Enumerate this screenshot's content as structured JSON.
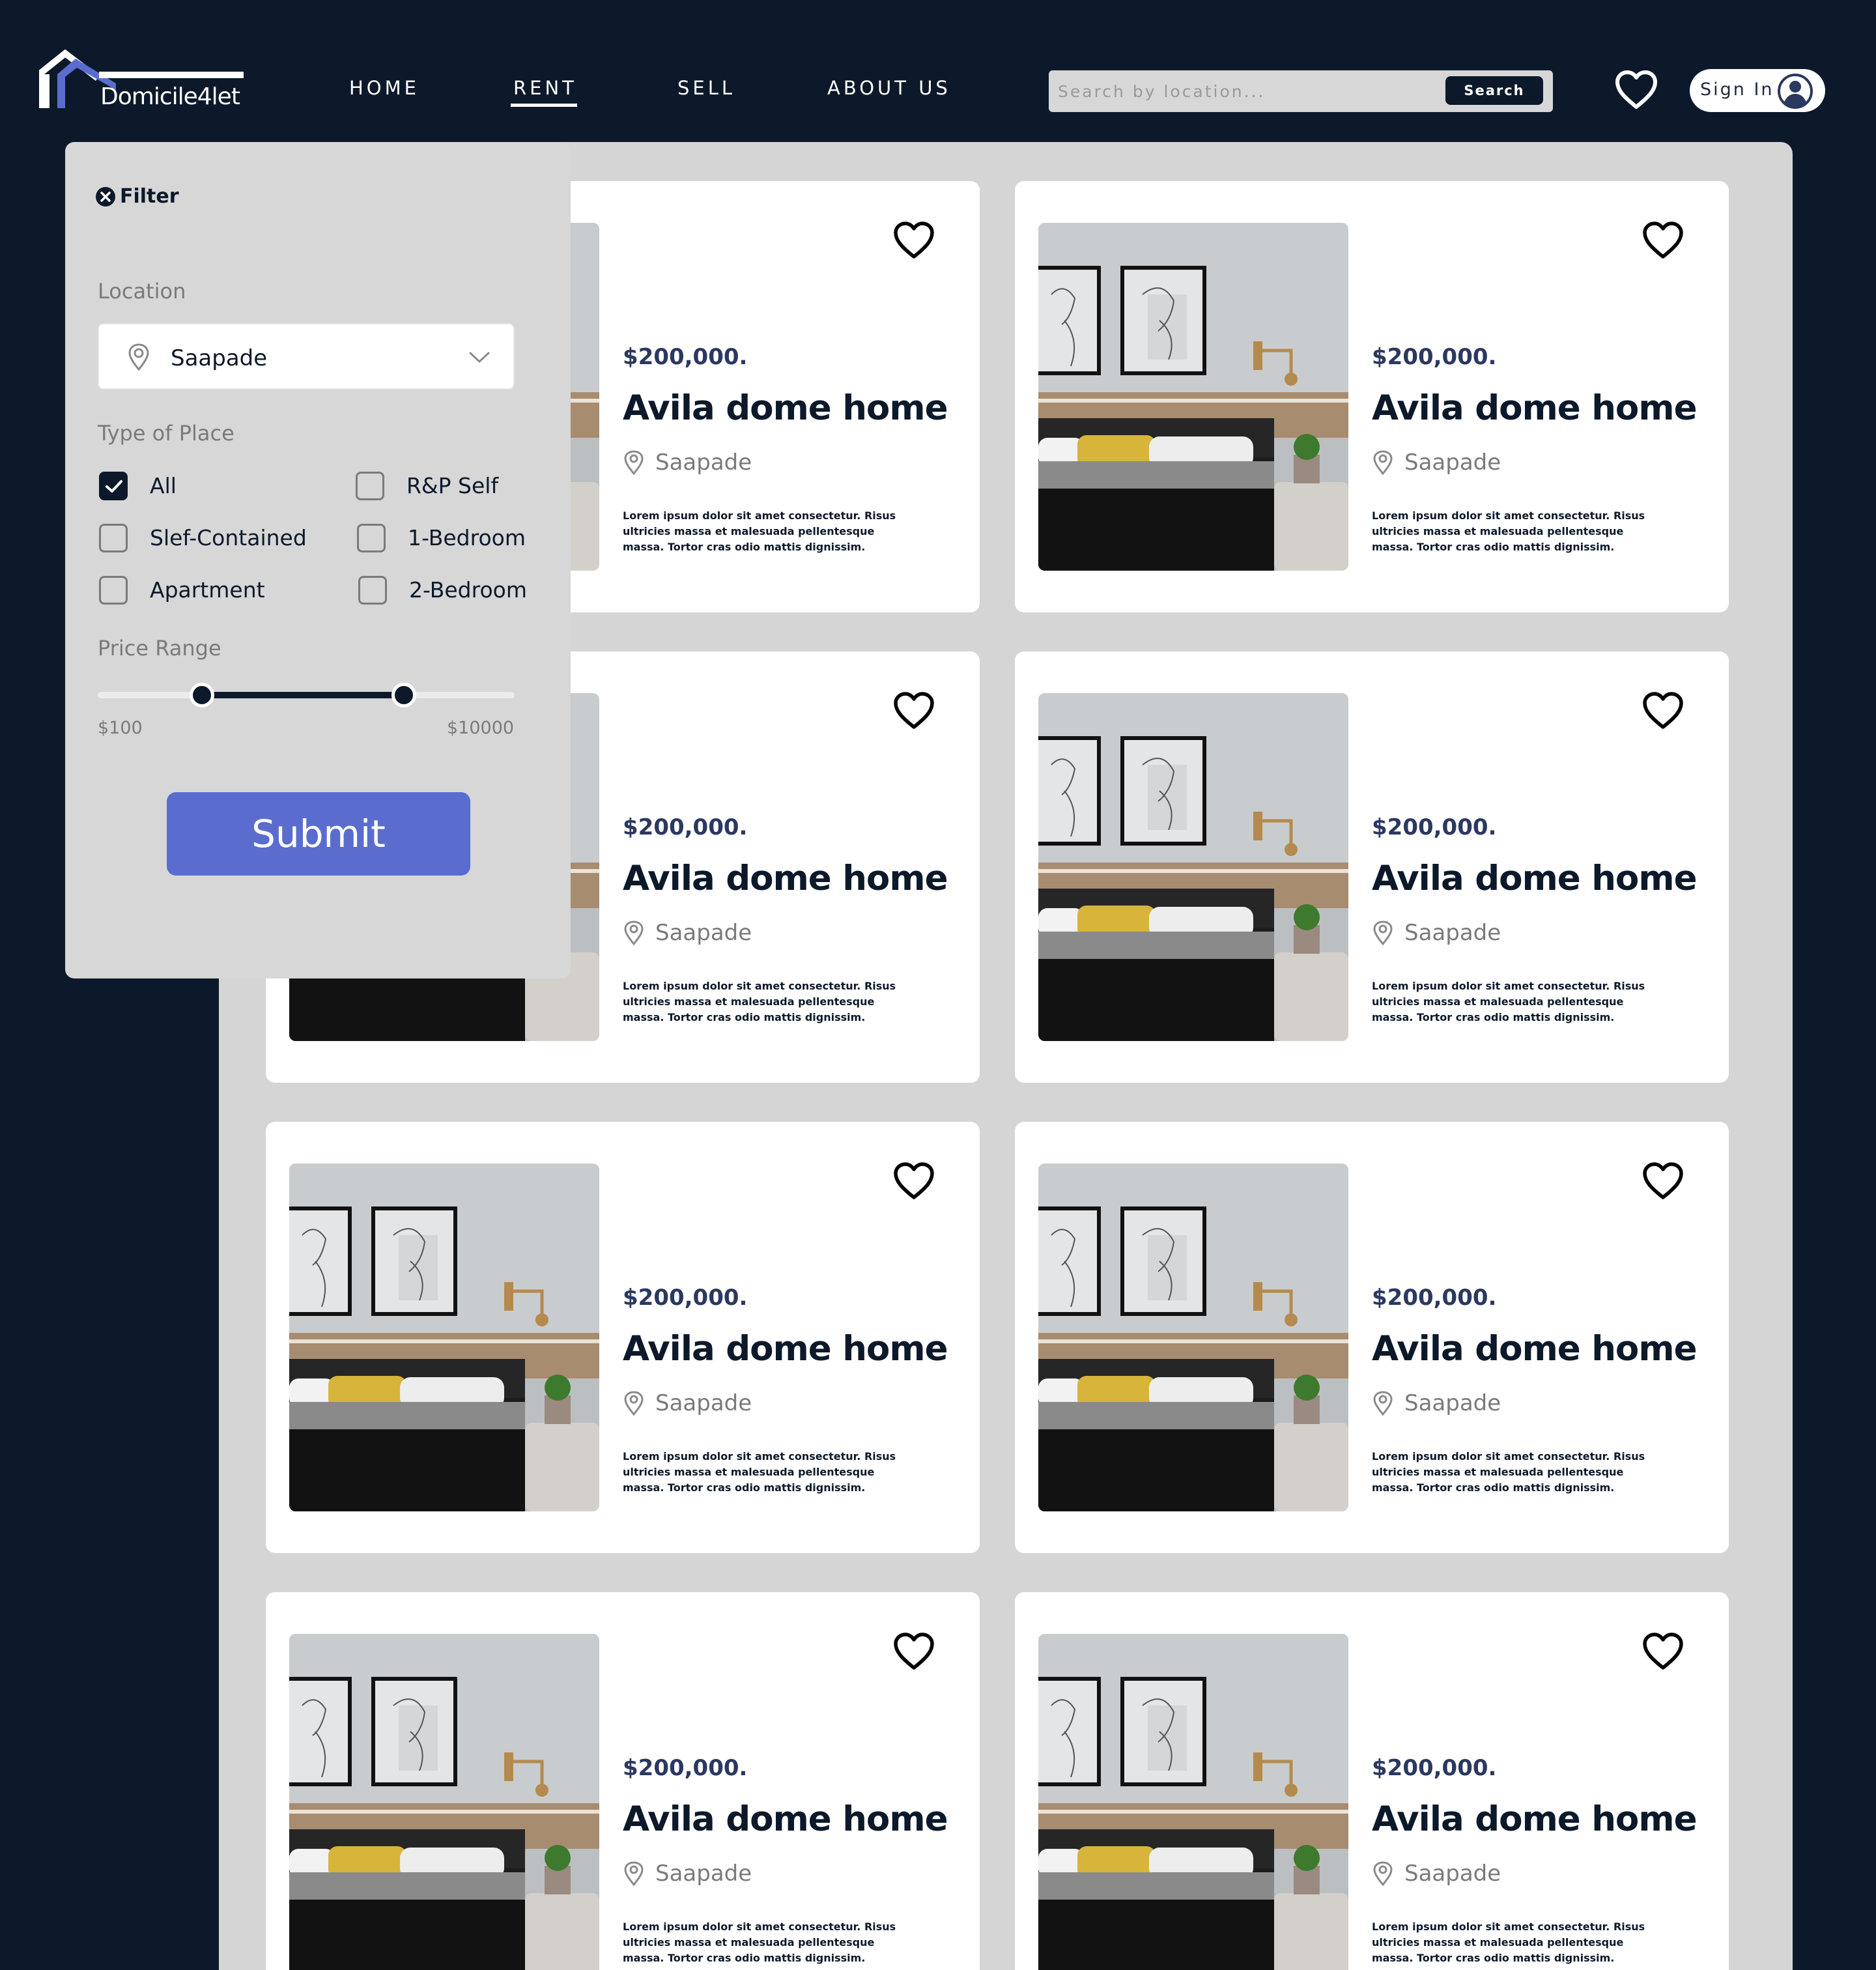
{
  "brand": {
    "name": "Domicile4let"
  },
  "nav": {
    "items": [
      {
        "label": "HOME"
      },
      {
        "label": "RENT"
      },
      {
        "label": "SELL"
      },
      {
        "label": "ABOUT US"
      }
    ],
    "active": "RENT"
  },
  "search": {
    "placeholder": "Search by location...",
    "button_label": "Search"
  },
  "account": {
    "signin_label": "Sign In"
  },
  "filter": {
    "title": "Filter",
    "location": {
      "label": "Location",
      "selected": "Saapade"
    },
    "type_of_place": {
      "label": "Type of Place",
      "options": [
        {
          "label": "All",
          "checked": true
        },
        {
          "label": "R&P Self",
          "checked": false
        },
        {
          "label": "Slef-Contained",
          "checked": false
        },
        {
          "label": "1-Bedroom",
          "checked": false
        },
        {
          "label": "Apartment",
          "checked": false
        },
        {
          "label": "2-Bedroom",
          "checked": false
        }
      ]
    },
    "price_range": {
      "label": "Price Range",
      "min_label": "$100",
      "max_label": "$10000"
    },
    "submit_label": "Submit"
  },
  "listings": [
    {
      "price": "$200,000.",
      "title": "Avila dome home",
      "location": "Saapade",
      "description": "Lorem ipsum dolor sit amet consectetur. Risus ultricies massa et malesuada pellentesque massa. Tortor cras odio mattis dignissim."
    },
    {
      "price": "$200,000.",
      "title": "Avila dome home",
      "location": "Saapade",
      "description": "Lorem ipsum dolor sit amet consectetur. Risus ultricies massa et malesuada pellentesque massa. Tortor cras odio mattis dignissim."
    },
    {
      "price": "$200,000.",
      "title": "Avila dome home",
      "location": "Saapade",
      "description": "Lorem ipsum dolor sit amet consectetur. Risus ultricies massa et malesuada pellentesque massa. Tortor cras odio mattis dignissim."
    },
    {
      "price": "$200,000.",
      "title": "Avila dome home",
      "location": "Saapade",
      "description": "Lorem ipsum dolor sit amet consectetur. Risus ultricies massa et malesuada pellentesque massa. Tortor cras odio mattis dignissim."
    },
    {
      "price": "$200,000.",
      "title": "Avila dome home",
      "location": "Saapade",
      "description": "Lorem ipsum dolor sit amet consectetur. Risus ultricies massa et malesuada pellentesque massa. Tortor cras odio mattis dignissim."
    },
    {
      "price": "$200,000.",
      "title": "Avila dome home",
      "location": "Saapade",
      "description": "Lorem ipsum dolor sit amet consectetur. Risus ultricies massa et malesuada pellentesque massa. Tortor cras odio mattis dignissim."
    },
    {
      "price": "$200,000.",
      "title": "Avila dome home",
      "location": "Saapade",
      "description": "Lorem ipsum dolor sit amet consectetur. Risus ultricies massa et malesuada pellentesque massa. Tortor cras odio mattis dignissim."
    },
    {
      "price": "$200,000.",
      "title": "Avila dome home",
      "location": "Saapade",
      "description": "Lorem ipsum dolor sit amet consectetur. Risus ultricies massa et malesuada pellentesque massa. Tortor cras odio mattis dignissim."
    }
  ],
  "colors": {
    "background": "#0c192a",
    "panel": "#d5d5d5",
    "accent": "#5a6dcf",
    "price_text": "#2b3860",
    "muted_text": "#7a7a7a"
  },
  "icons": [
    "logo-house-icon",
    "heart-icon",
    "user-avatar-icon",
    "close-icon",
    "location-pin-icon",
    "chevron-down-icon",
    "checkmark-icon"
  ]
}
